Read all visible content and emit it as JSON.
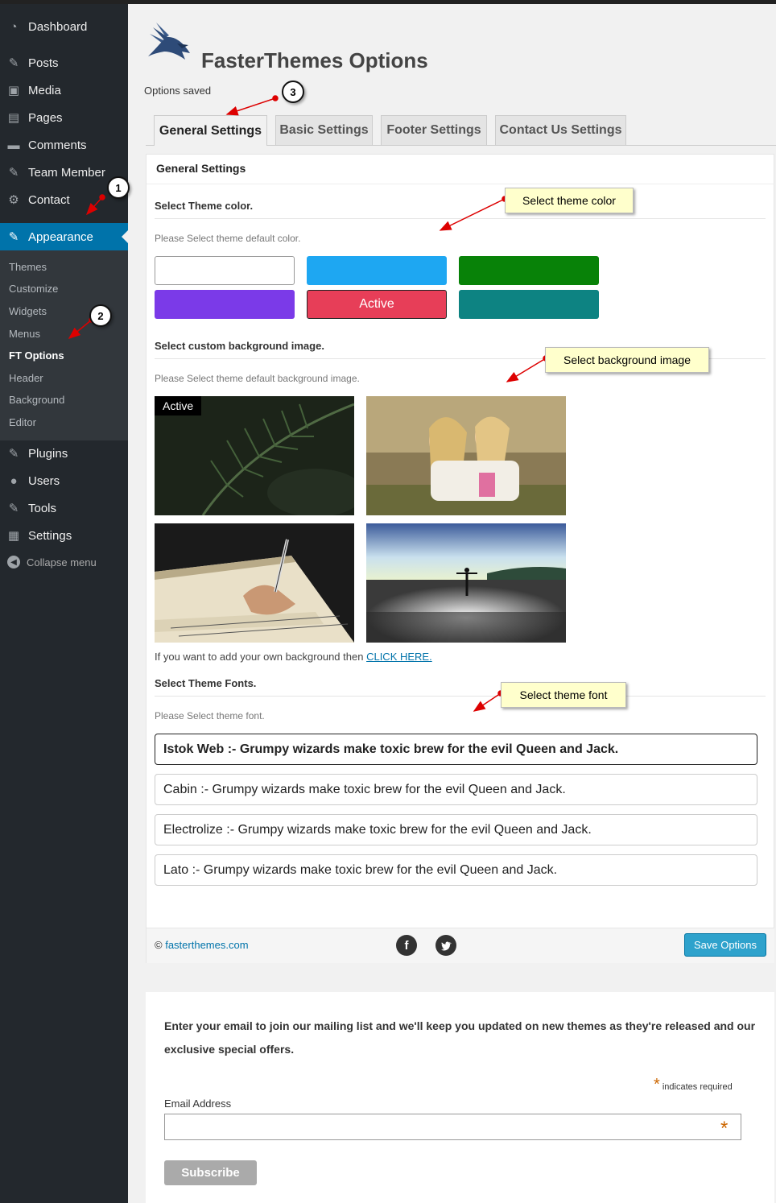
{
  "sidebar": {
    "items": [
      {
        "label": "Dashboard",
        "icon": "dashboard-icon",
        "glyph": "◔"
      },
      {
        "label": "Posts",
        "icon": "pin-icon",
        "glyph": "✎"
      },
      {
        "label": "Media",
        "icon": "media-icon",
        "glyph": "▣"
      },
      {
        "label": "Pages",
        "icon": "pages-icon",
        "glyph": "▤"
      },
      {
        "label": "Comments",
        "icon": "comments-icon",
        "glyph": "▬"
      },
      {
        "label": "Team Member",
        "icon": "pin-icon",
        "glyph": "✎"
      },
      {
        "label": "Contact",
        "icon": "gear-icon",
        "glyph": "⚙"
      },
      {
        "label": "Appearance",
        "icon": "brush-icon",
        "glyph": "✎"
      },
      {
        "label": "Plugins",
        "icon": "plug-icon",
        "glyph": "✎"
      },
      {
        "label": "Users",
        "icon": "user-icon",
        "glyph": "●"
      },
      {
        "label": "Tools",
        "icon": "wrench-icon",
        "glyph": "✎"
      },
      {
        "label": "Settings",
        "icon": "settings-icon",
        "glyph": "▦"
      }
    ],
    "submenu": [
      "Themes",
      "Customize",
      "Widgets",
      "Menus",
      "FT Options",
      "Header",
      "Background",
      "Editor"
    ],
    "collapse_label": "Collapse menu"
  },
  "header": {
    "title": "FasterThemes Options",
    "notice": "Options saved"
  },
  "tabs": [
    "General Settings",
    "Basic Settings",
    "Footer Settings",
    "Contact Us Settings"
  ],
  "panel": {
    "title": "General Settings",
    "color_section": {
      "title": "Select Theme color.",
      "desc": "Please Select theme default color.",
      "swatches": [
        "#ffffff",
        "#1ea7f2",
        "#088208",
        "#7b3ae8",
        "#e73e58",
        "#0d8382"
      ],
      "active_label": "Active"
    },
    "bg_section": {
      "title": "Select custom background image.",
      "desc": "Please Select theme default background image.",
      "active_label": "Active",
      "own_bg_text": "If you want to add your own background then",
      "own_bg_link": "CLICK HERE."
    },
    "font_section": {
      "title": "Select Theme Fonts.",
      "desc": "Please Select theme font.",
      "options": [
        "Istok Web :- Grumpy wizards make toxic brew for the evil Queen and Jack.",
        "Cabin :- Grumpy wizards make toxic brew for the evil Queen and Jack.",
        "Electrolize :- Grumpy wizards make toxic brew for the evil Queen and Jack.",
        "Lato :- Grumpy wizards make toxic brew for the evil Queen and Jack."
      ]
    },
    "footer": {
      "copyright_symbol": "©",
      "site_link": "fasterthemes.com",
      "save_label": "Save Options"
    }
  },
  "mailing": {
    "text": "Enter your email to join our mailing list and we'll keep you updated on new themes as they're released and our exclusive special offers.",
    "required_note": "indicates required",
    "required_star": "*",
    "email_label": "Email Address",
    "subscribe_label": "Subscribe"
  },
  "annotations": {
    "callouts": [
      "Select theme color",
      "Select background image",
      "Select theme font"
    ],
    "numbers": [
      "1",
      "2",
      "3"
    ]
  }
}
